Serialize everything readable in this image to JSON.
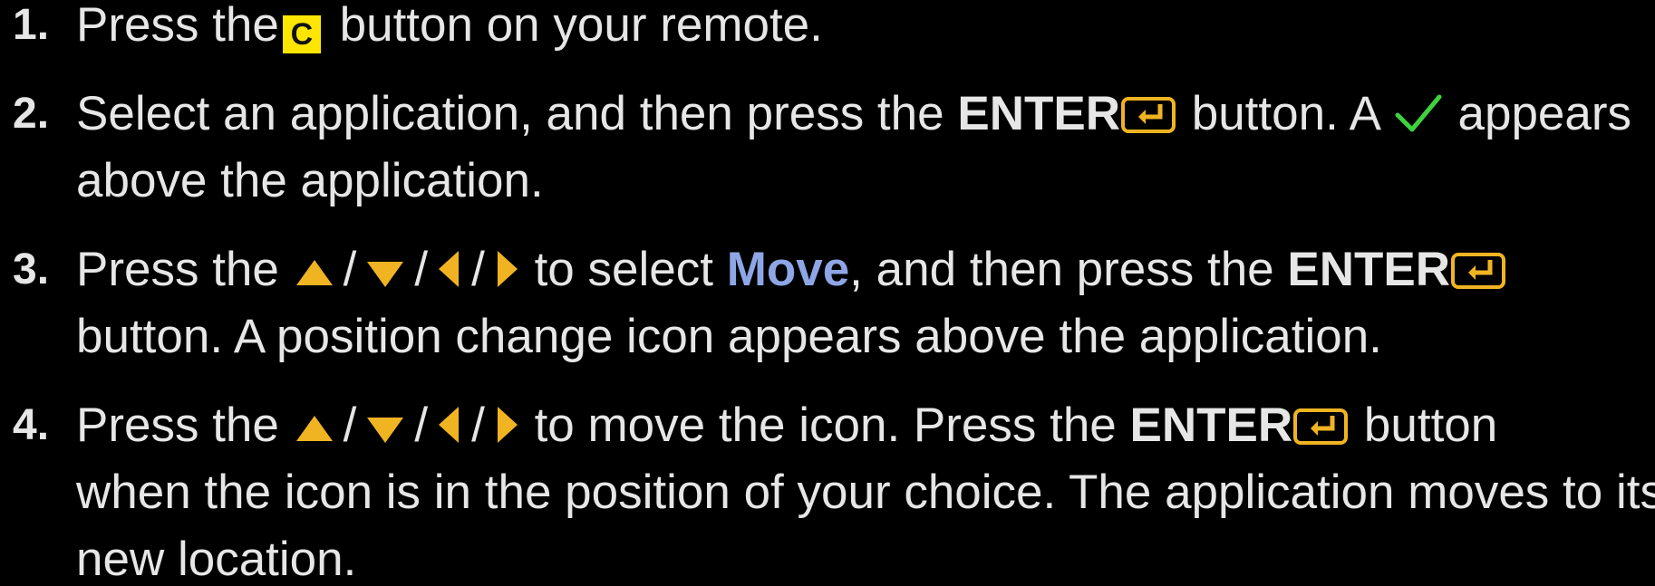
{
  "steps": [
    {
      "num": "1.",
      "a": "Press the",
      "c_key": "C",
      "b": "button on your remote."
    },
    {
      "num": "2.",
      "a": "Select an application, and then press the",
      "enter": "ENTER",
      "b": "button. A",
      "c": "appears",
      "line2": "above the application."
    },
    {
      "num": "3.",
      "a": "Press the",
      "slash": "/",
      "b": "to select",
      "move": "Move",
      "c": ", and then press the",
      "enter": "ENTER",
      "line2": "button. A position change icon appears above the application."
    },
    {
      "num": "4.",
      "a": "Press the",
      "slash": "/",
      "b": "to move the icon. Press the",
      "enter": "ENTER",
      "c": "button",
      "line2": "when the icon is in the position of your choice. The application moves to its",
      "line3": "new location."
    }
  ],
  "icons": {
    "accent": "#f0b422",
    "check": "#3ed23e",
    "c_key_bg": "#ffe600",
    "names": [
      "c-key-icon",
      "enter-icon",
      "check-icon",
      "arrow-up-icon",
      "arrow-down-icon",
      "arrow-left-icon",
      "arrow-right-icon"
    ]
  }
}
